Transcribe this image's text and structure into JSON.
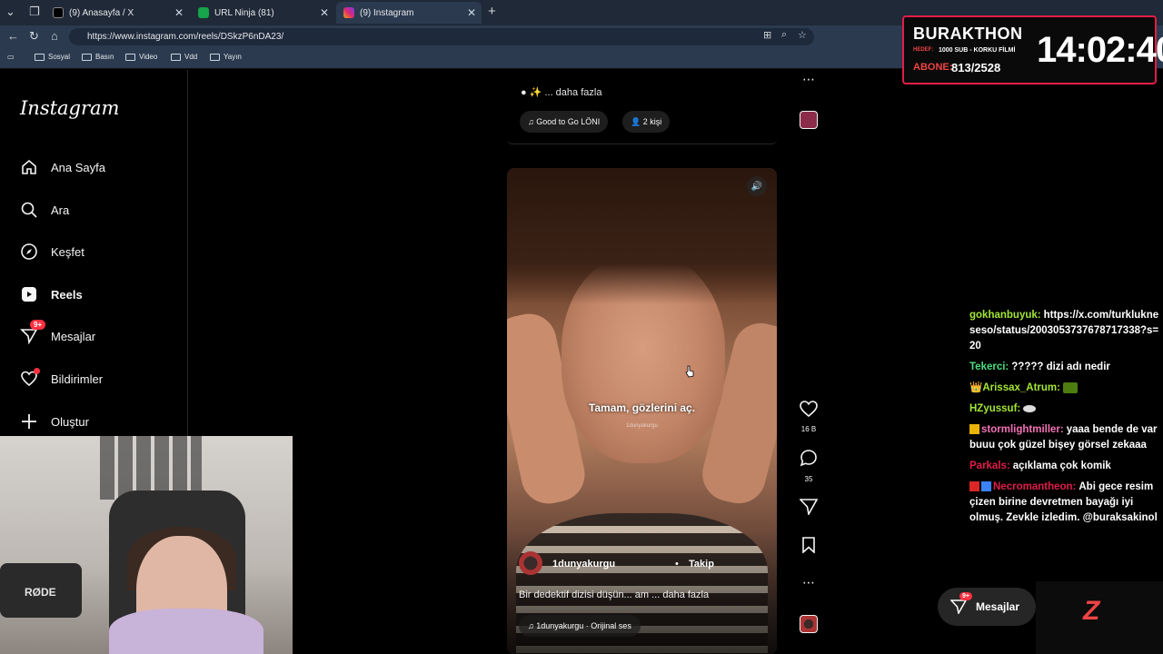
{
  "browser": {
    "tabs": [
      {
        "title": "(9) Anasayfa / X",
        "active": false
      },
      {
        "title": "URL Ninja (81)",
        "active": false
      },
      {
        "title": "(9) Instagram",
        "active": true
      }
    ],
    "url": "https://www.instagram.com/reels/DSkzP6nDA23/",
    "bookmarks": [
      "Sosyal",
      "Basın",
      "Video",
      "Vdd",
      "Yayın"
    ]
  },
  "sidebar": {
    "logo": "Instagram",
    "items": [
      {
        "label": "Ana Sayfa",
        "icon": "home-icon"
      },
      {
        "label": "Ara",
        "icon": "search-icon"
      },
      {
        "label": "Keşfet",
        "icon": "compass-icon"
      },
      {
        "label": "Reels",
        "icon": "reels-icon"
      },
      {
        "label": "Mesajlar",
        "icon": "messenger-icon",
        "badge": "9+"
      },
      {
        "label": "Bildirimler",
        "icon": "heart-icon"
      },
      {
        "label": "Oluştur",
        "icon": "plus-icon"
      }
    ]
  },
  "previous_reel": {
    "description": "... daha fazla",
    "song": "Good to Go  LÖNI",
    "people": "2 kişi"
  },
  "reel": {
    "subtitle": "Tamam, gözlerini aç.",
    "watermark": "1dunyakurgu",
    "author": "1dunyakurgu",
    "follow_sep": "•",
    "follow": "Takip",
    "caption": "Bir dedektif dizisi düşün... am ... daha fazla",
    "audio": "1dunyakurgu · Orijinal ses",
    "likes": "16 B",
    "comments": "35"
  },
  "overlay": {
    "streamer": "BURAKTHON",
    "hedef_label": "HEDEF:",
    "hedef_text": "1000 SUB - KORKU FİLMİ",
    "abone_label": "ABONE:",
    "abone_value": "813/2528",
    "clock": "14:02:40",
    "webcam_mic_label": "RØDE"
  },
  "chat": [
    {
      "user": "gokhanbuyuk:",
      "color": "#a3e635",
      "text": "https://x.com/turklukneseso/status/2003053737678717338?s=20"
    },
    {
      "user": "Tekerci:",
      "color": "#4ade80",
      "text": "????? dizi adı nedir"
    },
    {
      "user": "Arissax_Atrum:",
      "color": "#a3e635",
      "text": ""
    },
    {
      "user": "HZyussuf:",
      "color": "#a3e635",
      "text": ""
    },
    {
      "user": "stormlightmiller:",
      "color": "#f472b6",
      "text": "yaaa bende de var buuu çok güzel bişey görsel zekaaa"
    },
    {
      "user": "Parkals:",
      "color": "#e11d48",
      "text": "açıklama çok komik"
    },
    {
      "user": "Necromantheon:",
      "color": "#e11d48",
      "text": "Abi gece resim çizen birine devretmen bayağı iyi olmuş. Zevkle izledim. @buraksakinol"
    }
  ],
  "messages_button": {
    "label": "Mesajlar",
    "badge": "9+"
  },
  "colors": {
    "accent": "#ff3040",
    "overlay_border": "#e11d48",
    "background": "#000000"
  }
}
